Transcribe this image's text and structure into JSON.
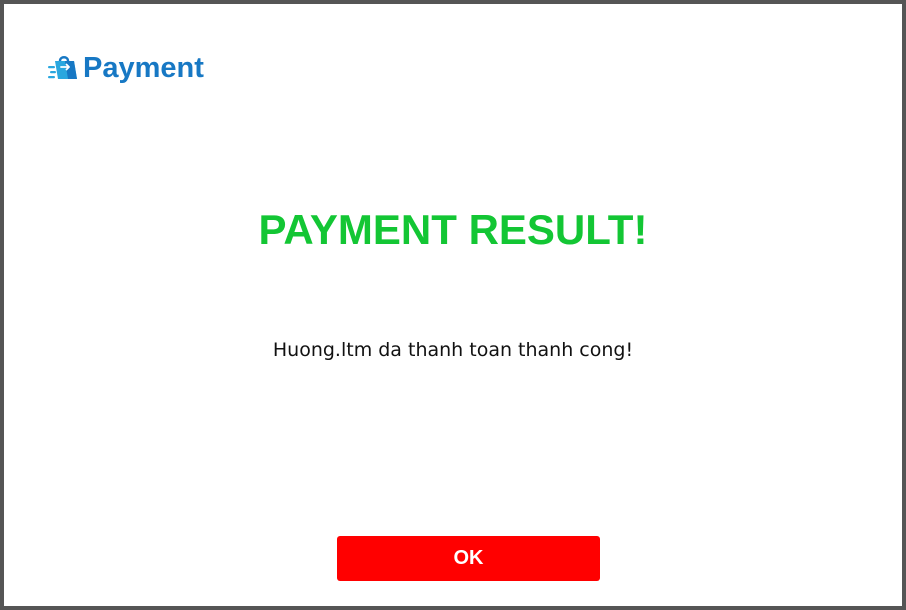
{
  "header": {
    "brand_icon": "shopping-bag-icon",
    "brand_text": "Payment",
    "brand_color": "#1778c4"
  },
  "result": {
    "title": "PAYMENT RESULT!",
    "title_color": "#13c634",
    "message": "Huong.ltm da thanh toan thanh cong!"
  },
  "actions": {
    "ok_label": "OK",
    "ok_color": "#ff0000"
  }
}
